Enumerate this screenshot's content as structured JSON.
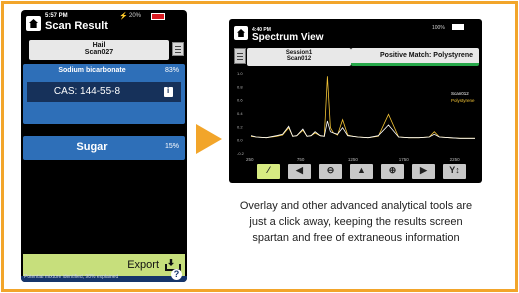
{
  "scan_result": {
    "time": "5:57 PM",
    "title": "Scan Result",
    "battery": "20%",
    "sample_name": "Hail",
    "scan_id": "Scan027",
    "components": [
      {
        "name": "Sodium bicarbonate",
        "percent": "83%",
        "cas": "CAS: 144-55-8"
      },
      {
        "name": "Sugar",
        "percent": "15%"
      }
    ],
    "export_label": "Export",
    "footer_text": "Potential mixture identified, 98% explained",
    "help_glyph": "?"
  },
  "spectrum_view": {
    "time": "4:40 PM",
    "title": "Spectrum View",
    "battery": "100%",
    "session": "Session1",
    "scan_id": "Scan012",
    "match_text": "Positive Match:  Polystyrene",
    "toolbar_buttons": [
      "overlay-icon",
      "prev-icon",
      "zoom-out-icon",
      "peak-pick-icon",
      "zoom-in-icon",
      "next-icon",
      "y-scale-icon"
    ]
  },
  "caption": "Overlay and other advanced analytical tools are just a click away, keeping the results screen spartan and free of extraneous information",
  "colors": {
    "frame": "#f2a52a",
    "component_blue": "#2e6fb8",
    "cas_navy": "#16315a",
    "export_green": "#c7df7c",
    "match_green": "#27a84a",
    "trace_white": "#ffffff",
    "trace_yellow": "#f2c335"
  },
  "chart_data": {
    "type": "line",
    "x_ticks": [
      "250",
      "750",
      "1250",
      "1750",
      "2250"
    ],
    "y_ticks": [
      "1.0",
      "0.8",
      "0.6",
      "0.4",
      "0.2",
      "0.0",
      "-0.2"
    ],
    "xlim": [
      250,
      2450
    ],
    "ylim": [
      -0.2,
      1.0
    ],
    "series": [
      {
        "name": "Scan012",
        "color": "#ffffff",
        "x": [
          250,
          300,
          400,
          500,
          560,
          620,
          660,
          700,
          760,
          800,
          840,
          880,
          930,
          970,
          1000,
          1030,
          1060,
          1100,
          1150,
          1200,
          1250,
          1300,
          1400,
          1500,
          1600,
          1700,
          1800,
          1900,
          2000,
          2050,
          2100,
          2200,
          2300,
          2450
        ],
        "y": [
          0.06,
          0.04,
          0.03,
          0.06,
          0.08,
          0.2,
          0.05,
          0.06,
          0.16,
          0.05,
          0.06,
          0.12,
          0.06,
          0.05,
          0.28,
          0.12,
          0.1,
          0.08,
          0.18,
          0.06,
          0.05,
          0.04,
          0.03,
          0.06,
          0.22,
          0.04,
          0.03,
          0.03,
          0.04,
          0.08,
          0.04,
          0.03,
          0.02,
          0.02
        ]
      },
      {
        "name": "Polystyrene",
        "color": "#f2c335",
        "x": [
          250,
          300,
          400,
          500,
          560,
          620,
          660,
          700,
          760,
          800,
          840,
          880,
          930,
          970,
          1000,
          1030,
          1060,
          1100,
          1150,
          1200,
          1250,
          1300,
          1400,
          1500,
          1600,
          1700,
          1800,
          1900,
          2000,
          2050,
          2100,
          2200,
          2300,
          2450
        ],
        "y": [
          0.05,
          0.04,
          0.03,
          0.05,
          0.07,
          0.18,
          0.05,
          0.06,
          0.14,
          0.05,
          0.06,
          0.1,
          0.06,
          0.05,
          0.95,
          0.18,
          0.1,
          0.07,
          0.3,
          0.07,
          0.05,
          0.04,
          0.03,
          0.05,
          0.38,
          0.04,
          0.03,
          0.03,
          0.04,
          0.12,
          0.04,
          0.03,
          0.02,
          0.02
        ]
      }
    ]
  }
}
